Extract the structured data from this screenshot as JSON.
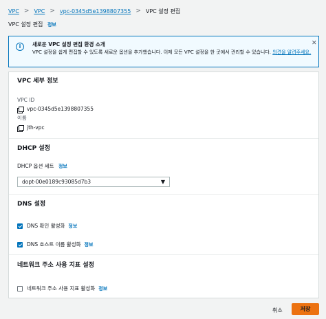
{
  "breadcrumbs": [
    "VPC",
    "VPC",
    "vpc-0345d5e1398807355",
    "VPC 설정 편집"
  ],
  "breadcrumb_separator": ">",
  "page_title": "VPC 설정 편집",
  "info_label": "정보",
  "banner": {
    "title": "새로운 VPC 설정 편집 환경 소개",
    "body": "VPC 설정을 쉽게 편집할 수 있도록 새로운 옵션을 추가했습니다. 이제 모든 VPC 설정을 한 곳에서 관리할 수 있습니다. ",
    "feedback_link": "의견을 알려주세요.",
    "icon": "info-circle-icon",
    "close_glyph": "✕"
  },
  "vpc_details": {
    "heading": "VPC 세부 정보",
    "id_label": "VPC ID",
    "id_value": "vpc-0345d5e1398807355",
    "name_label": "이름",
    "name_value": "jth-vpc"
  },
  "dhcp": {
    "heading": "DHCP 설정",
    "option_label": "DHCP 옵션 세트",
    "selected": "dopt-00e0189c93085d7b3",
    "caret": "▼"
  },
  "dns": {
    "heading": "DNS 설정",
    "resolution_label": "DNS 확인 활성화",
    "resolution_checked": true,
    "hostnames_label": "DNS 호스트 이름 활성화",
    "hostnames_checked": true
  },
  "network_metrics": {
    "heading": "네트워크 주소 사용 지표 설정",
    "enable_label": "네트워크 주소 사용 지표 활성화",
    "enable_checked": false
  },
  "footer": {
    "cancel_label": "취소",
    "save_label": "저장"
  },
  "colors": {
    "link": "#0073bb",
    "primary_button": "#ec7211",
    "banner_bg": "#f1faff"
  }
}
